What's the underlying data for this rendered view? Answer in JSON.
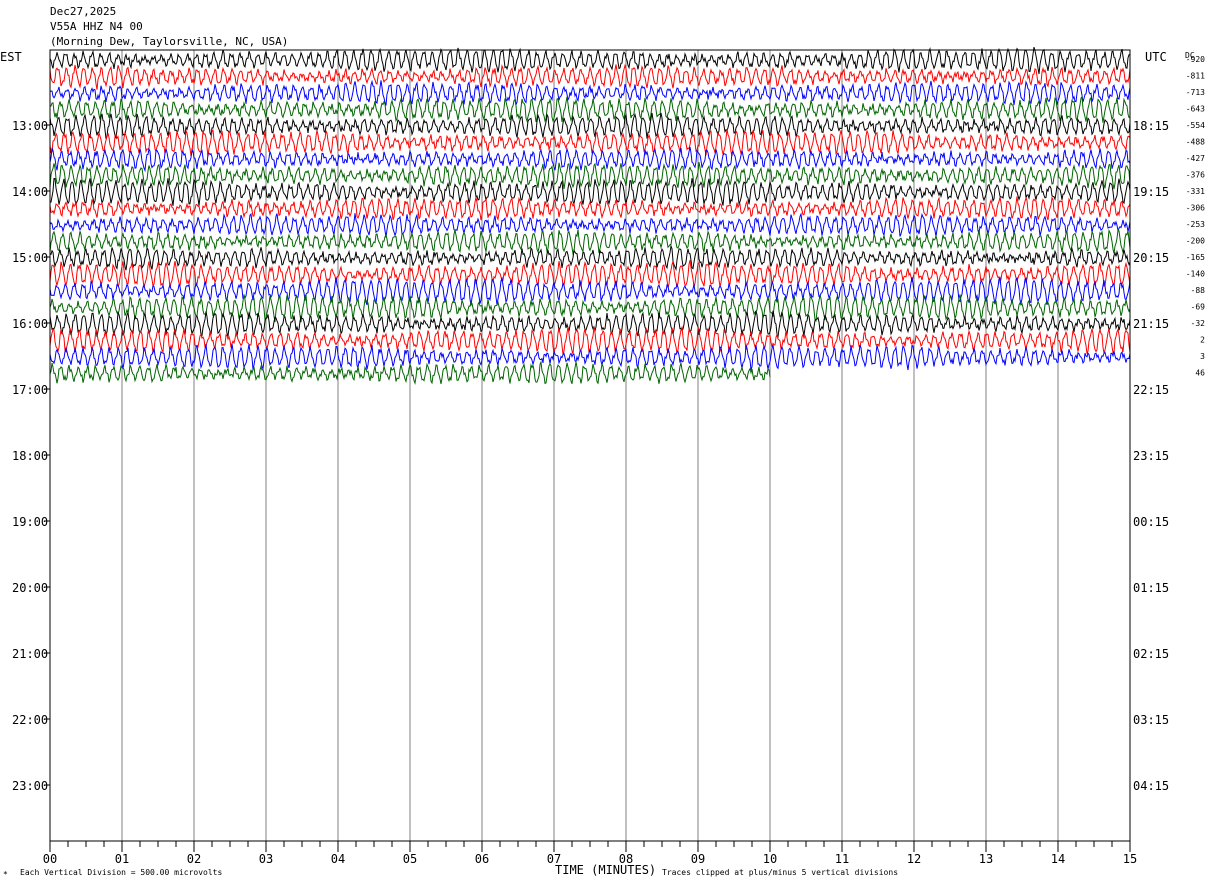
{
  "header": {
    "date": "Dec27,2025",
    "station": "V55A HHZ N4 00",
    "location": "(Morning Dew, Taylorsville, NC, USA)"
  },
  "axes": {
    "left_tz": "EST",
    "right_tz": "UTC",
    "dc_label": "DC",
    "x_title": "TIME (MINUTES)",
    "vertical_division_note": "Each Vertical Division =  500.00 microvolts",
    "clip_note": "Traces clipped at plus/minus 5 vertical divisions"
  },
  "chart_data": {
    "type": "line",
    "title": "",
    "xlabel": "TIME (MINUTES)",
    "xlim": [
      0,
      15
    ],
    "x_ticks": [
      "00",
      "01",
      "02",
      "03",
      "04",
      "05",
      "06",
      "07",
      "08",
      "09",
      "10",
      "11",
      "12",
      "13",
      "14",
      "15"
    ],
    "left_hour_labels": [
      "13:00",
      "14:00",
      "15:00",
      "16:00",
      "17:00",
      "18:00",
      "19:00",
      "20:00",
      "21:00",
      "22:00",
      "23:00"
    ],
    "right_hour_labels": [
      "18:15",
      "19:15",
      "20:15",
      "21:15",
      "22:15",
      "23:15",
      "00:15",
      "01:15",
      "02:15",
      "03:15",
      "04:15"
    ],
    "trace_colors": [
      "#000000",
      "#ff0000",
      "#0000ff",
      "#006400"
    ],
    "trace_count": 20,
    "last_trace_end_minute": 10,
    "dc_offsets": [
      "-920",
      "-811",
      "-713",
      "-643",
      "-554",
      "-488",
      "-427",
      "-376",
      "-331",
      "-306",
      "-253",
      "-200",
      "-165",
      "-140",
      "-88",
      "-69",
      "-32",
      "2",
      "3",
      "46"
    ]
  }
}
